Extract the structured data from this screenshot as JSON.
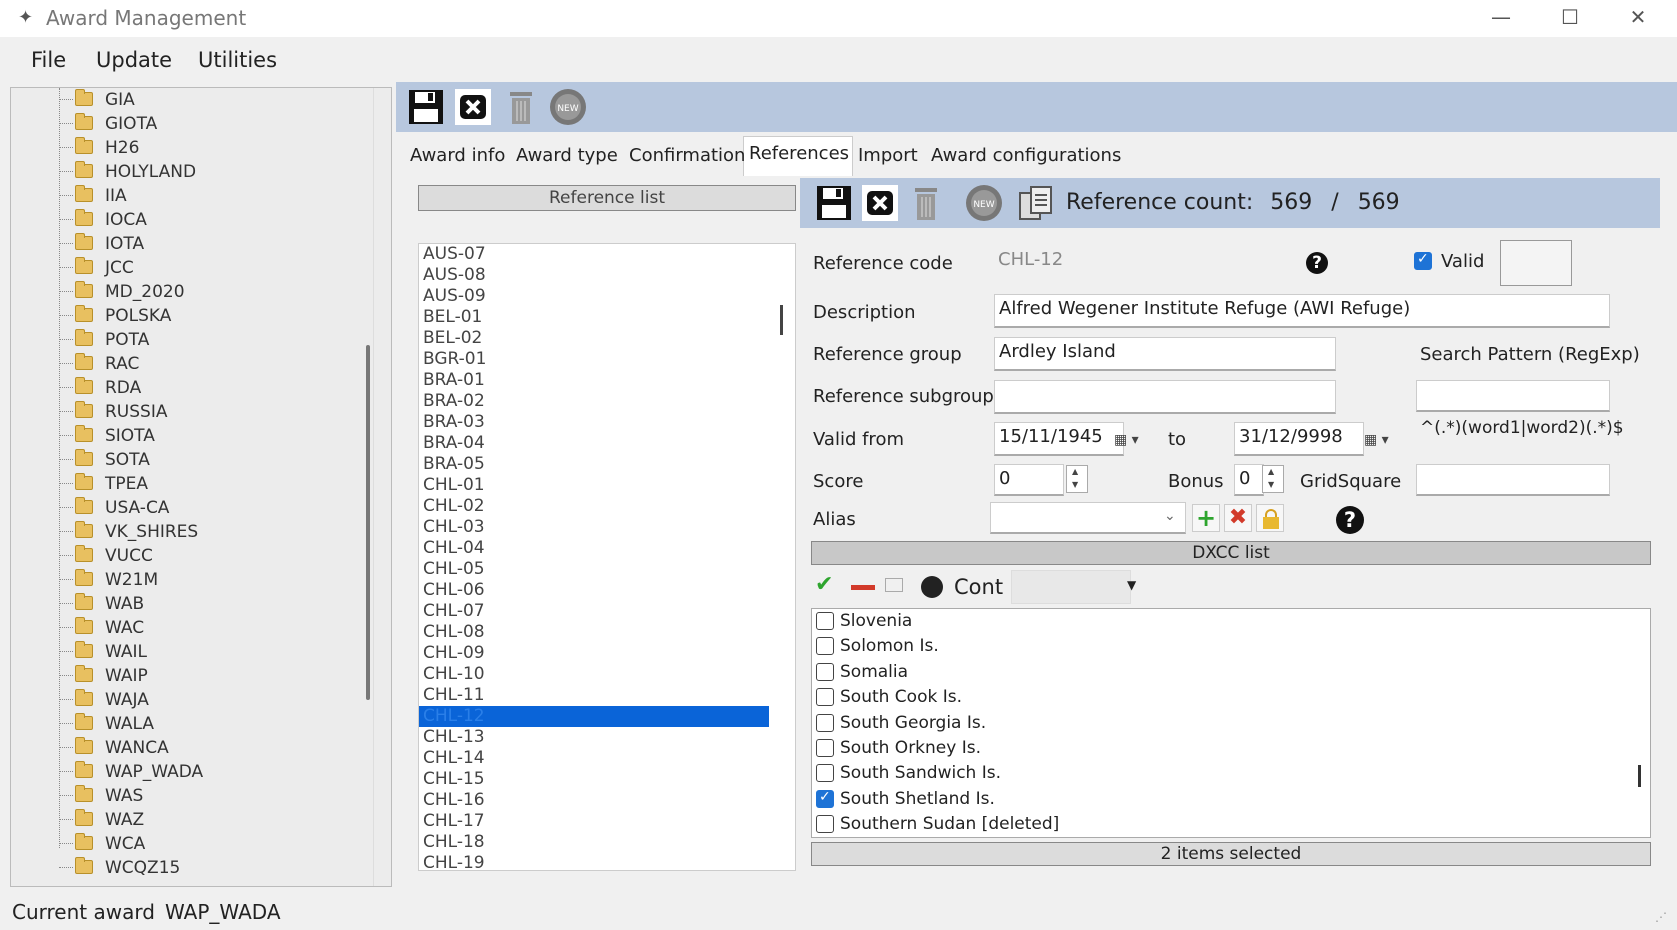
{
  "window": {
    "title": "Award Management",
    "min": "—",
    "max": "☐",
    "close": "✕"
  },
  "menu": [
    "File",
    "Update",
    "Utilities"
  ],
  "tree": [
    "GIA",
    "GIOTA",
    "H26",
    "HOLYLAND",
    "IIA",
    "IOCA",
    "IOTA",
    "JCC",
    "MD_2020",
    "POLSKA",
    "POTA",
    "RAC",
    "RDA",
    "RUSSIA",
    "SIOTA",
    "SOTA",
    "TPEA",
    "USA-CA",
    "VK_SHIRES",
    "VUCC",
    "W21M",
    "WAB",
    "WAC",
    "WAIL",
    "WAIP",
    "WAJA",
    "WALA",
    "WANCA",
    "WAP_WADA",
    "WAS",
    "WAZ",
    "WCA",
    "WCQZ15"
  ],
  "tabs": [
    "Award info",
    "Award type",
    "Confirmation",
    "References",
    "Import",
    "Award configurations"
  ],
  "reference_list": {
    "header": "Reference list",
    "items": [
      "AUS-07",
      "AUS-08",
      "AUS-09",
      "BEL-01",
      "BEL-02",
      "BGR-01",
      "BRA-01",
      "BRA-02",
      "BRA-03",
      "BRA-04",
      "BRA-05",
      "CHL-01",
      "CHL-02",
      "CHL-03",
      "CHL-04",
      "CHL-05",
      "CHL-06",
      "CHL-07",
      "CHL-08",
      "CHL-09",
      "CHL-10",
      "CHL-11",
      "CHL-12",
      "CHL-13",
      "CHL-14",
      "CHL-15",
      "CHL-16",
      "CHL-17",
      "CHL-18",
      "CHL-19"
    ],
    "selected": "CHL-12"
  },
  "detail": {
    "count_label": "Reference count:",
    "count": "569",
    "slash": "/",
    "total": "569",
    "code_label": "Reference code",
    "code_value": "CHL-12",
    "valid_label": "Valid",
    "description_label": "Description",
    "description_value": "Alfred Wegener Institute Refuge (AWI Refuge)",
    "group_label": "Reference group",
    "group_value": "Ardley Island",
    "subgroup_label": "Reference subgroup",
    "subgroup_value": "",
    "search_pattern_label": "Search Pattern (RegExp)",
    "search_pattern_example": "^(.*)(word1|word2)(.*)$",
    "valid_from_label": "Valid from",
    "valid_from_value": "15/11/1945",
    "to_label": "to",
    "valid_to_value": "31/12/9998",
    "score_label": "Score",
    "score_value": "0",
    "bonus_label": "Bonus",
    "bonus_value": "0",
    "gridsquare_label": "GridSquare",
    "alias_label": "Alias",
    "help": "?"
  },
  "dxcc": {
    "header": "DXCC list",
    "filter_label": "Cont",
    "items": [
      {
        "name": "Slovenia",
        "checked": false
      },
      {
        "name": "Solomon Is.",
        "checked": false
      },
      {
        "name": "Somalia",
        "checked": false
      },
      {
        "name": "South Cook Is.",
        "checked": false
      },
      {
        "name": "South Georgia Is.",
        "checked": false
      },
      {
        "name": "South Orkney Is.",
        "checked": false
      },
      {
        "name": "South Sandwich Is.",
        "checked": false
      },
      {
        "name": "South Shetland Is.",
        "checked": true
      },
      {
        "name": "Southern Sudan [deleted]",
        "checked": false
      }
    ],
    "footer": "2 items selected"
  },
  "status": {
    "label": "Current award",
    "value": "WAP_WADA"
  },
  "colors": {
    "toolbar": "#b7c7de",
    "selection": "#0a64d8",
    "check": "#1e73d6"
  }
}
